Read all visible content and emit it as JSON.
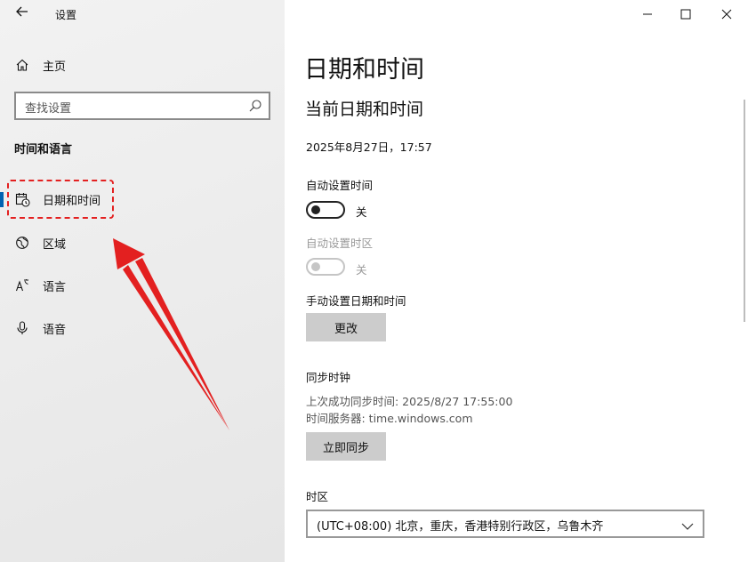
{
  "window": {
    "title": "设置",
    "back_icon": "back-arrow-icon",
    "controls": [
      "minimize-icon",
      "maximize-icon",
      "close-icon"
    ]
  },
  "sidebar": {
    "home": {
      "label": "主页",
      "icon": "home-icon"
    },
    "search": {
      "placeholder": "查找设置",
      "icon": "search-icon"
    },
    "section_title": "时间和语言",
    "items": [
      {
        "label": "日期和时间",
        "icon": "calendar-clock-icon",
        "selected": true
      },
      {
        "label": "区域",
        "icon": "globe-icon",
        "selected": false
      },
      {
        "label": "语言",
        "icon": "language-icon",
        "selected": false
      },
      {
        "label": "语音",
        "icon": "microphone-icon",
        "selected": false
      }
    ],
    "annotation": {
      "color": "#e32020"
    }
  },
  "main": {
    "title": "日期和时间",
    "subtitle": "当前日期和时间",
    "current_datetime": "2025年8月27日，17:57",
    "auto_time": {
      "label": "自动设置时间",
      "state": "关",
      "enabled": true,
      "on": false
    },
    "auto_timezone": {
      "label": "自动设置时区",
      "state": "关",
      "enabled": false,
      "on": false
    },
    "manual": {
      "label": "手动设置日期和时间",
      "button": "更改"
    },
    "sync": {
      "label": "同步时钟",
      "last_sync": "上次成功同步时间: 2025/8/27 17:55:00",
      "server": "时间服务器: time.windows.com",
      "button": "立即同步"
    },
    "timezone": {
      "label": "时区",
      "value": "(UTC+08:00) 北京，重庆，香港特别行政区，乌鲁木齐"
    }
  },
  "colors": {
    "accent": "#0063b1",
    "annotation": "#e32020",
    "button_bg": "#cccccc"
  }
}
